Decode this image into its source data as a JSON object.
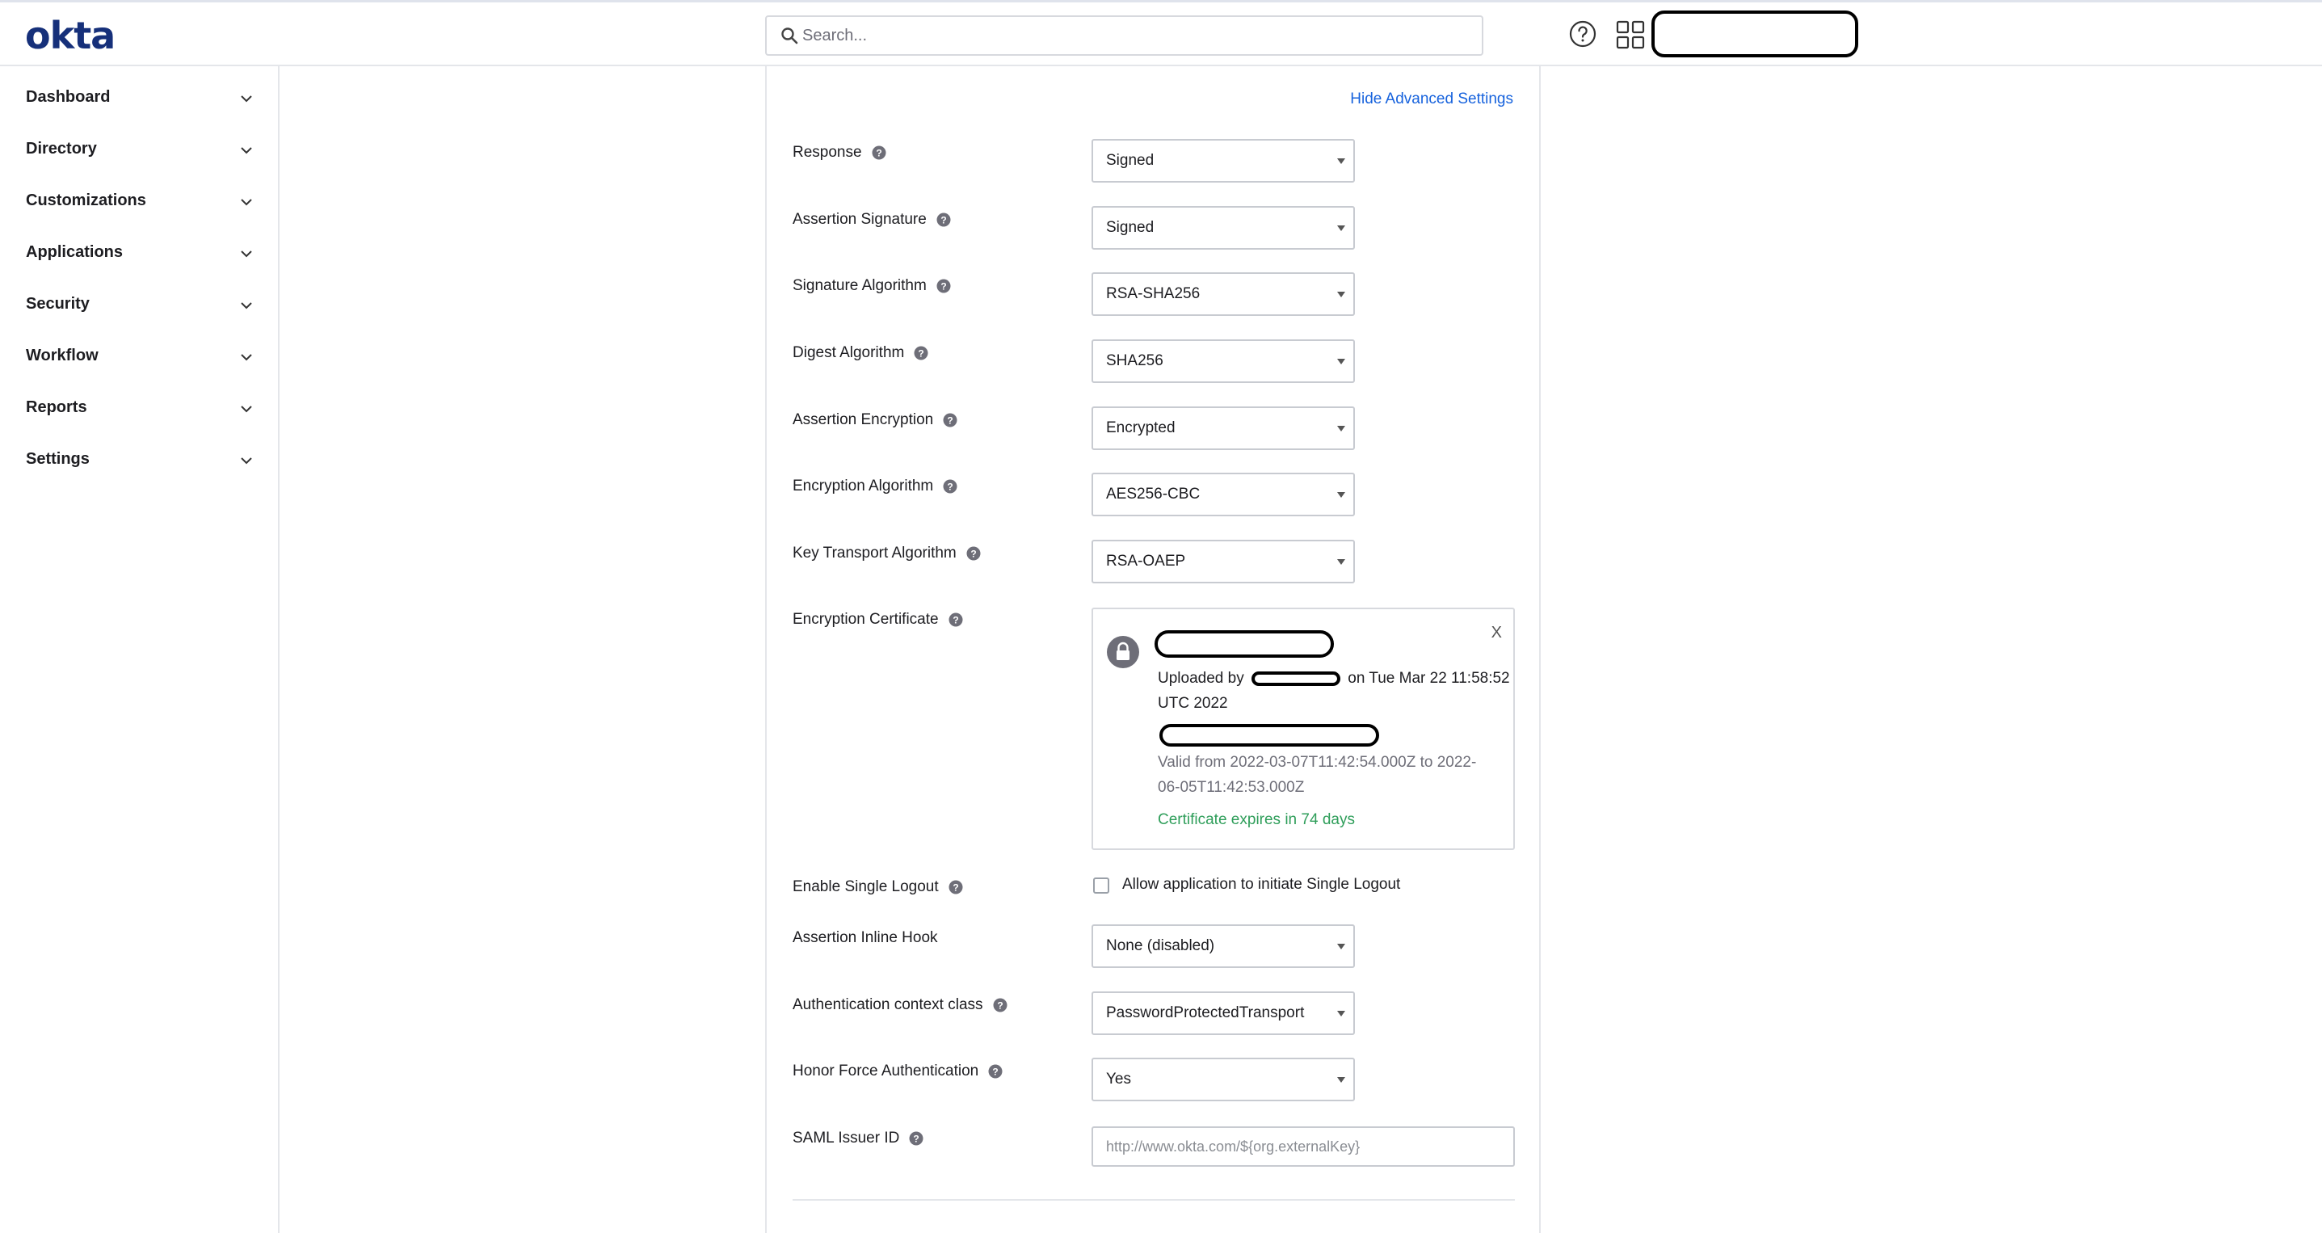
{
  "header": {
    "logo": "okta",
    "search": {
      "placeholder": "Search..."
    }
  },
  "sidebar": {
    "items": [
      {
        "label": "Dashboard"
      },
      {
        "label": "Directory"
      },
      {
        "label": "Customizations"
      },
      {
        "label": "Applications"
      },
      {
        "label": "Security"
      },
      {
        "label": "Workflow"
      },
      {
        "label": "Reports"
      },
      {
        "label": "Settings"
      }
    ]
  },
  "main": {
    "hide_advanced_label": "Hide Advanced Settings",
    "fields": {
      "response": {
        "label": "Response",
        "value": "Signed"
      },
      "assertion_signature": {
        "label": "Assertion Signature",
        "value": "Signed"
      },
      "signature_algorithm": {
        "label": "Signature Algorithm",
        "value": "RSA-SHA256"
      },
      "digest_algorithm": {
        "label": "Digest Algorithm",
        "value": "SHA256"
      },
      "assertion_encryption": {
        "label": "Assertion Encryption",
        "value": "Encrypted"
      },
      "encryption_algorithm": {
        "label": "Encryption Algorithm",
        "value": "AES256-CBC"
      },
      "key_transport_algorithm": {
        "label": "Key Transport Algorithm",
        "value": "RSA-OAEP"
      },
      "encryption_certificate": {
        "label": "Encryption Certificate"
      },
      "enable_single_logout": {
        "label": "Enable Single Logout",
        "checkbox_label": "Allow application to initiate Single Logout",
        "checked": false
      },
      "assertion_inline_hook": {
        "label": "Assertion Inline Hook",
        "value": "None (disabled)"
      },
      "auth_context_class": {
        "label": "Authentication context class",
        "value": "PasswordProtectedTransport"
      },
      "honor_force_auth": {
        "label": "Honor Force Authentication",
        "value": "Yes"
      },
      "saml_issuer_id": {
        "label": "SAML Issuer ID",
        "value": "",
        "placeholder": "http://www.okta.com/${org.externalKey}"
      }
    },
    "certificate": {
      "close_label": "X",
      "uploaded_by_prefix": "Uploaded by",
      "uploaded_on": "on Tue Mar 22 11:58:52",
      "uploaded_tz": "UTC 2022",
      "valid_line1": "Valid from 2022-03-07T11:42:54.000Z to 2022-",
      "valid_line2": "06-05T11:42:53.000Z",
      "expires": "Certificate expires in 74 days"
    }
  },
  "colors": {
    "brand": "#16307a",
    "link": "#1662dd",
    "success": "#2f9e5a"
  },
  "icons": {
    "search": "search-icon",
    "help": "help-circle-icon",
    "apps": "grid-apps-icon",
    "chevron": "chevron-down-icon",
    "question": "question-mark-icon",
    "lock": "lock-icon"
  }
}
